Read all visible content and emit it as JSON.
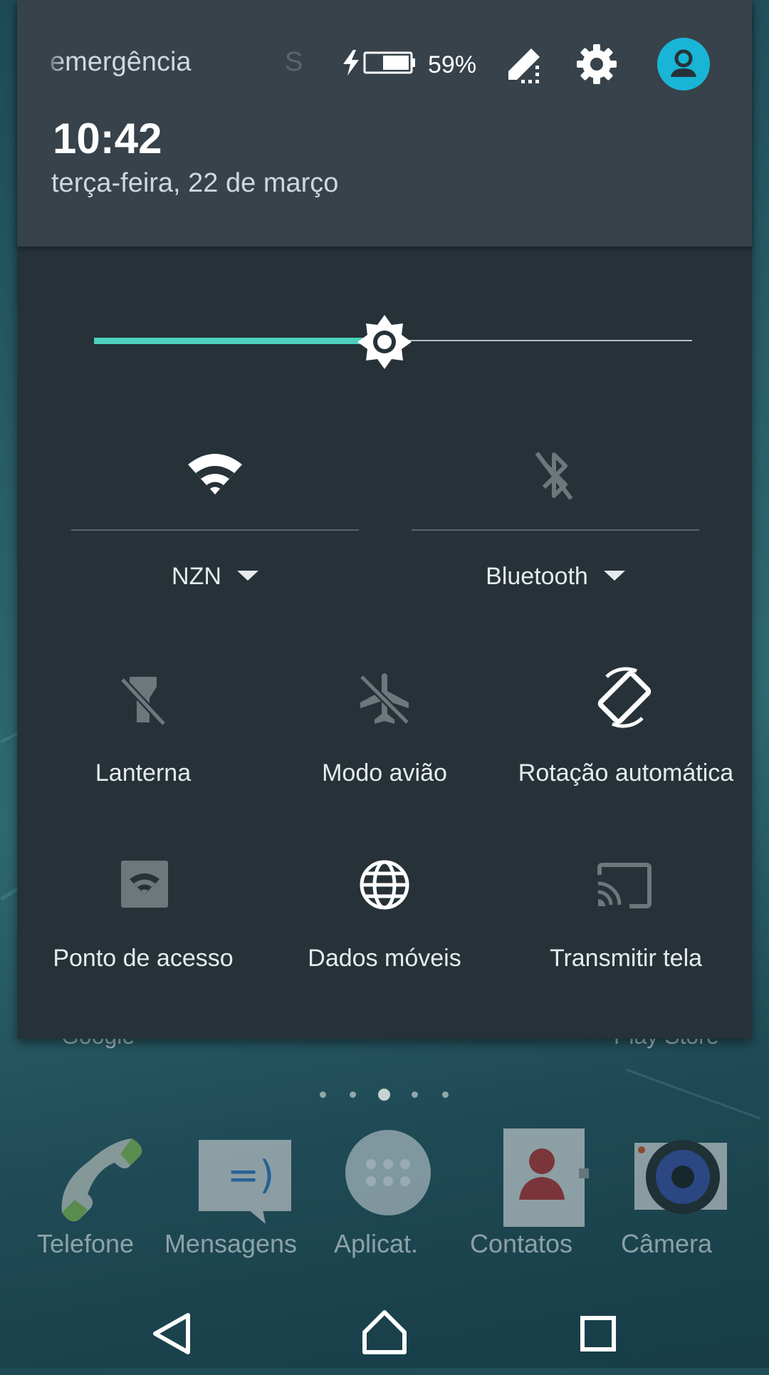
{
  "status_bar": {
    "carrier_text": "emergência",
    "carrier_text_2": "S",
    "battery_percent": "59%",
    "battery_level": 0.59,
    "charging": true
  },
  "header": {
    "time": "10:42",
    "date": "terça-feira, 22 de março"
  },
  "brightness": {
    "level": 0.5,
    "accent": "#4dd0bd"
  },
  "quick_settings": {
    "wifi": {
      "label": "NZN",
      "icon": "wifi-icon",
      "enabled": true
    },
    "bluetooth": {
      "label": "Bluetooth",
      "icon": "bluetooth-off-icon",
      "enabled": false
    },
    "tiles": [
      {
        "label": "Lanterna",
        "icon": "flashlight-off-icon",
        "enabled": false
      },
      {
        "label": "Modo avião",
        "icon": "airplane-off-icon",
        "enabled": false
      },
      {
        "label": "Rotação automática",
        "icon": "rotate-icon",
        "enabled": true
      },
      {
        "label": "Ponto de acesso",
        "icon": "hotspot-icon",
        "enabled": false
      },
      {
        "label": "Dados móveis",
        "icon": "globe-icon",
        "enabled": true
      },
      {
        "label": "Transmitir tela",
        "icon": "cast-icon",
        "enabled": false
      }
    ]
  },
  "home": {
    "partial_labels": [
      "Google",
      "Play Store"
    ],
    "page_count": 5,
    "active_page": 3,
    "dock": [
      {
        "label": "Telefone",
        "icon": "phone-icon"
      },
      {
        "label": "Mensagens",
        "icon": "messages-icon"
      },
      {
        "label": "Aplicat.",
        "icon": "apps-icon"
      },
      {
        "label": "Contatos",
        "icon": "contacts-icon"
      },
      {
        "label": "Câmera",
        "icon": "camera-icon"
      }
    ]
  },
  "navigation": {
    "buttons": [
      "back-icon",
      "home-icon",
      "recents-icon"
    ]
  },
  "colors": {
    "shade": "#263238",
    "header": "#37424a",
    "accent": "#4dd0bd",
    "avatar": "#19b5d6"
  }
}
